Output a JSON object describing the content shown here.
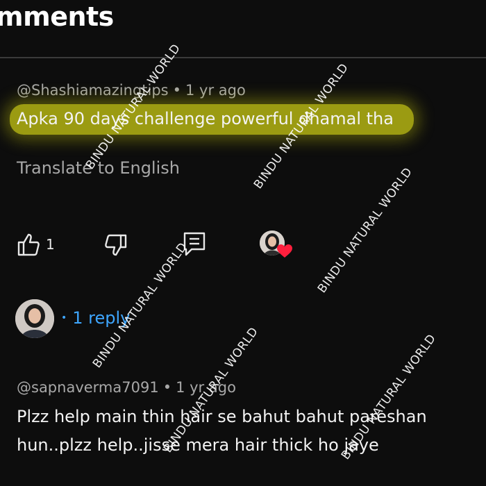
{
  "header": {
    "title": "mments"
  },
  "comment1": {
    "author": "@Shashiamazingtips",
    "separator": "•",
    "time": "1 yr ago",
    "text": "Apka 90 days challenge powerful dhamal tha",
    "translate_label": "Translate to English",
    "like_count": "1",
    "replies_bullet": "•",
    "replies_label": "1 reply"
  },
  "comment2": {
    "author": "@sapnaverma7091",
    "separator": "•",
    "time": "1 yr ago",
    "text_line1": "Plzz help main thin hair se bahut bahut pareshan",
    "text_line2": "hun..plzz help..jisse mera hair thick ho jaye"
  },
  "watermark": {
    "text": "BINDU NATURAL WORLD"
  },
  "icons": {
    "like": "thumbs-up-icon",
    "dislike": "thumbs-down-icon",
    "reply": "comment-reply-icon",
    "creator_heart": "heart-icon"
  },
  "colors": {
    "background": "#0d0d0d",
    "highlight": "#c4c414",
    "link": "#3ea6ff",
    "heart": "#ff1f3d"
  }
}
